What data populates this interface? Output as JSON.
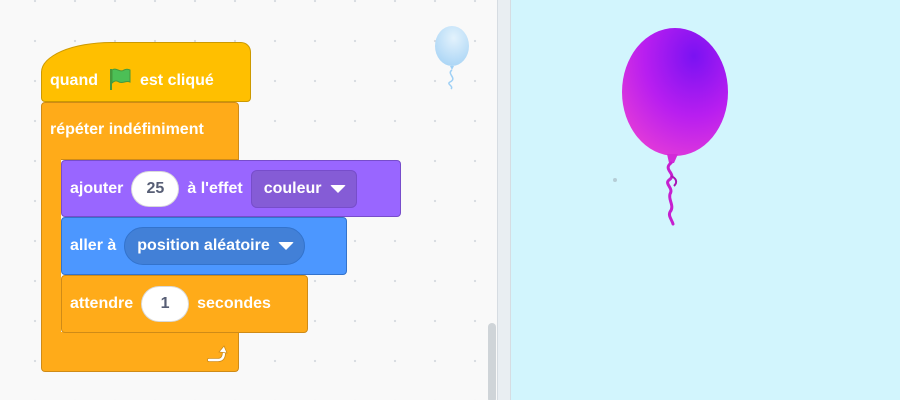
{
  "colors": {
    "events": "#ffbf00",
    "control": "#ffab19",
    "looks": "#9966ff",
    "motion": "#4c97ff",
    "stage_background": "#d2f5fd",
    "balloon": "#c52af2"
  },
  "icons": {
    "green_flag": "green-flag-icon",
    "loop_arrow": "loop-arrow-icon",
    "dropdown_caret": "chevron-down-icon"
  },
  "script": {
    "hat": {
      "before": "quand",
      "after": "est cliqué"
    },
    "forever": {
      "label": "répéter indéfiniment"
    },
    "effect": {
      "before": "ajouter",
      "amount": "25",
      "middle": "à l'effet",
      "effect_option": "couleur"
    },
    "goto": {
      "before": "aller à",
      "target_option": "position aléatoire"
    },
    "wait": {
      "before": "attendre",
      "amount": "1",
      "after": "secondes"
    }
  }
}
